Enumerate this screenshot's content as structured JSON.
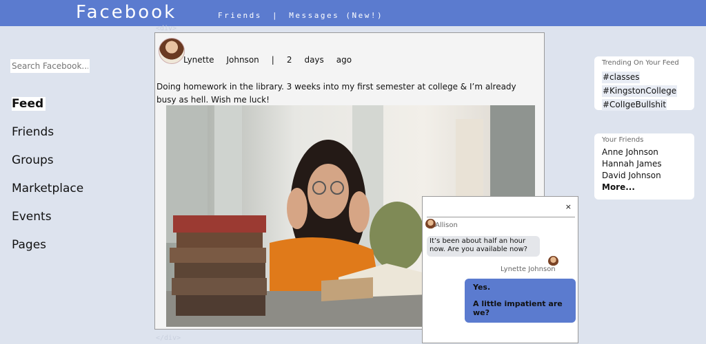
{
  "app": {
    "brand": "Facebook"
  },
  "topnav": {
    "friends_label": "Friends",
    "separator": "|",
    "messages_label": "Messages (New!)"
  },
  "sidebar": {
    "search_placeholder": "Search Facebook...",
    "items": [
      {
        "label": "Feed",
        "active": true
      },
      {
        "label": "Friends",
        "active": false
      },
      {
        "label": "Groups",
        "active": false
      },
      {
        "label": "Marketplace",
        "active": false
      },
      {
        "label": "Events",
        "active": false
      },
      {
        "label": "Pages",
        "active": false
      }
    ]
  },
  "post": {
    "author_first": "Lynette",
    "author_last": "Johnson",
    "separator": "|",
    "time_num": "2",
    "time_unit": "days",
    "time_suffix": "ago",
    "text": "Doing homework in the library. 3 weeks into my first semester at college & I’m already busy as hell. Wish me luck!",
    "photo_icon": "student-studying-photo"
  },
  "trending": {
    "title": "Trending On Your Feed",
    "tags": [
      "#classes",
      "#KingstonCollege",
      "#ColIgeBullshit"
    ]
  },
  "friends": {
    "title": "Your Friends",
    "names": [
      "Anne Johnson",
      "Hannah James",
      "David Johnson"
    ],
    "more_label": "More..."
  },
  "chat": {
    "close_label": "×",
    "incoming_name": "Allison",
    "incoming_message": "It’s been about half an hour now. Are you available now?",
    "outgoing_name": "Lynette Johnson",
    "outgoing_line1": "Yes.",
    "outgoing_line2": "A little impatient are we?"
  },
  "ghost_text": {
    "top": "<div>",
    "bottom": "</div>"
  },
  "colors": {
    "accent": "#5b7bcf",
    "background": "#dde3ee",
    "card": "#ffffff"
  }
}
